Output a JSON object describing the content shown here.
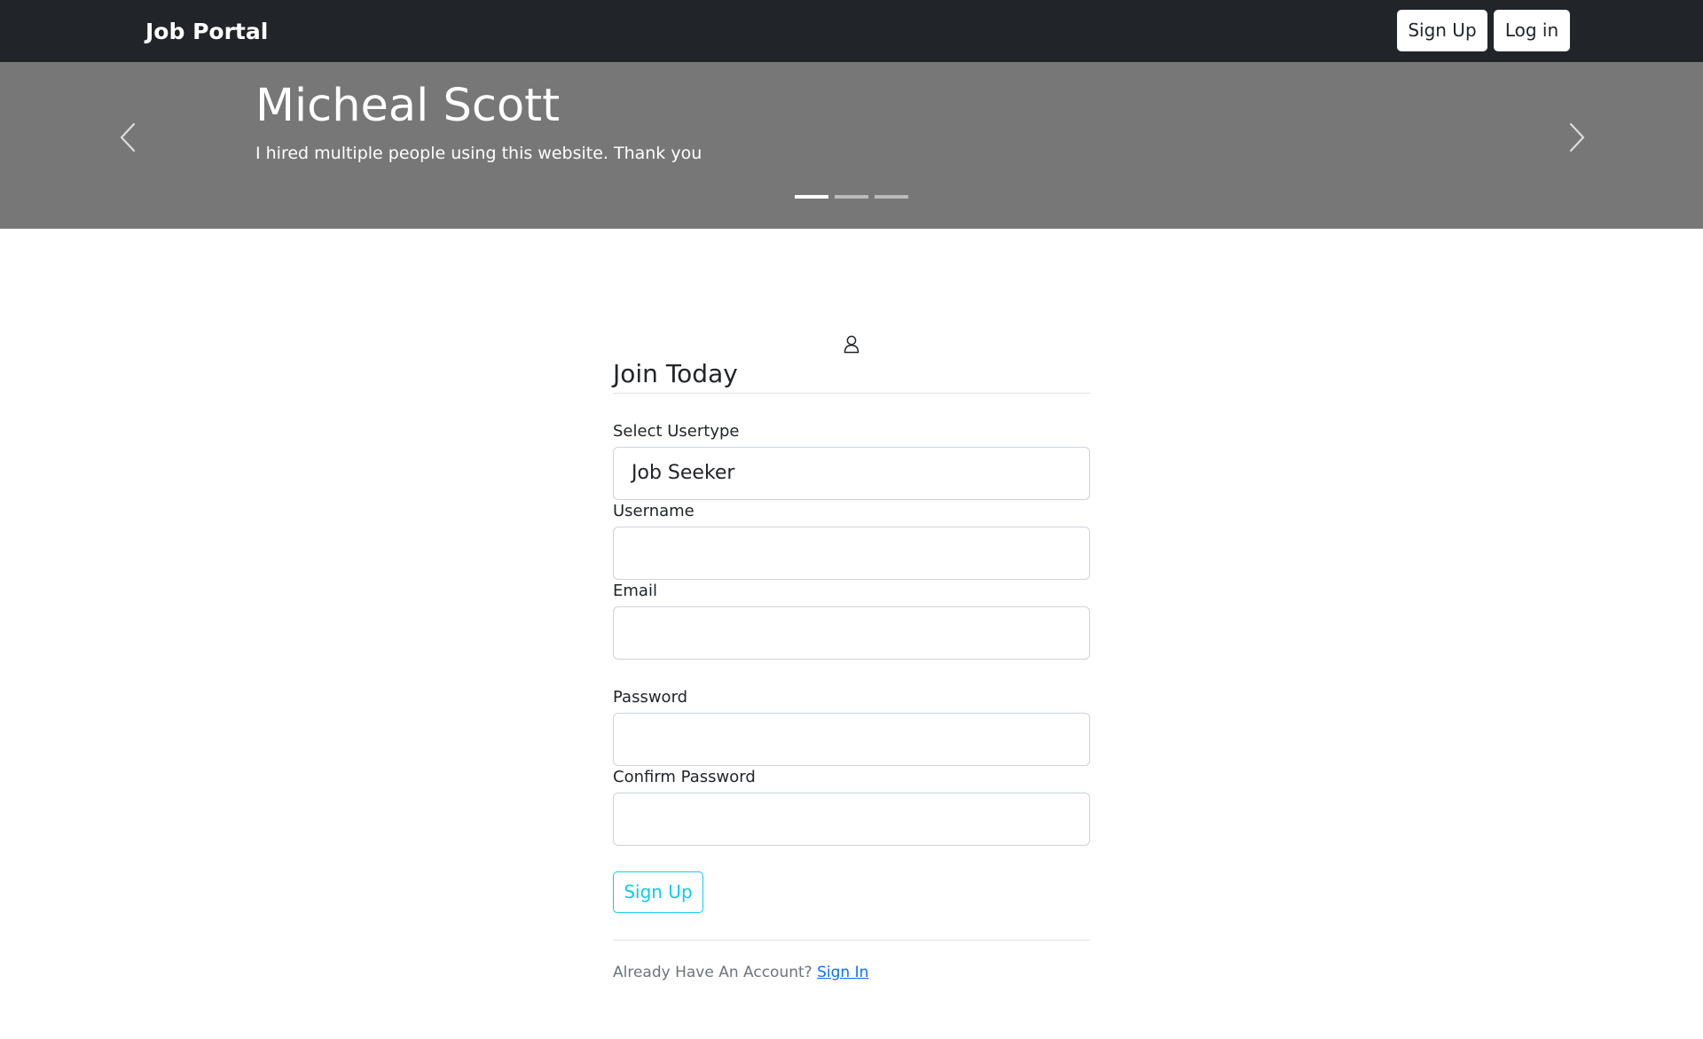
{
  "navbar": {
    "brand": "Job Portal",
    "signup_label": "Sign Up",
    "login_label": "Log in",
    "background": "#212529"
  },
  "carousel": {
    "background": "#777777",
    "active_index": 0,
    "slide_count": 3,
    "slide": {
      "title": "Micheal Scott",
      "text": "I hired multiple people using this website. Thank you"
    },
    "prev_icon": "chevron-left-icon",
    "next_icon": "chevron-right-icon"
  },
  "form": {
    "icon": "person-icon",
    "legend": "Join Today",
    "usertype": {
      "label": "Select Usertype",
      "value": "Job Seeker"
    },
    "username": {
      "label": "Username",
      "value": ""
    },
    "email": {
      "label": "Email",
      "value": ""
    },
    "password": {
      "label": "Password",
      "value": ""
    },
    "confirm_password": {
      "label": "Confirm Password",
      "value": ""
    },
    "submit_label": "Sign Up",
    "submit_color": "#0dcaf0",
    "footer": {
      "text": "Already Have An Account? ",
      "link": "Sign In",
      "link_color": "#0d6efd"
    }
  }
}
